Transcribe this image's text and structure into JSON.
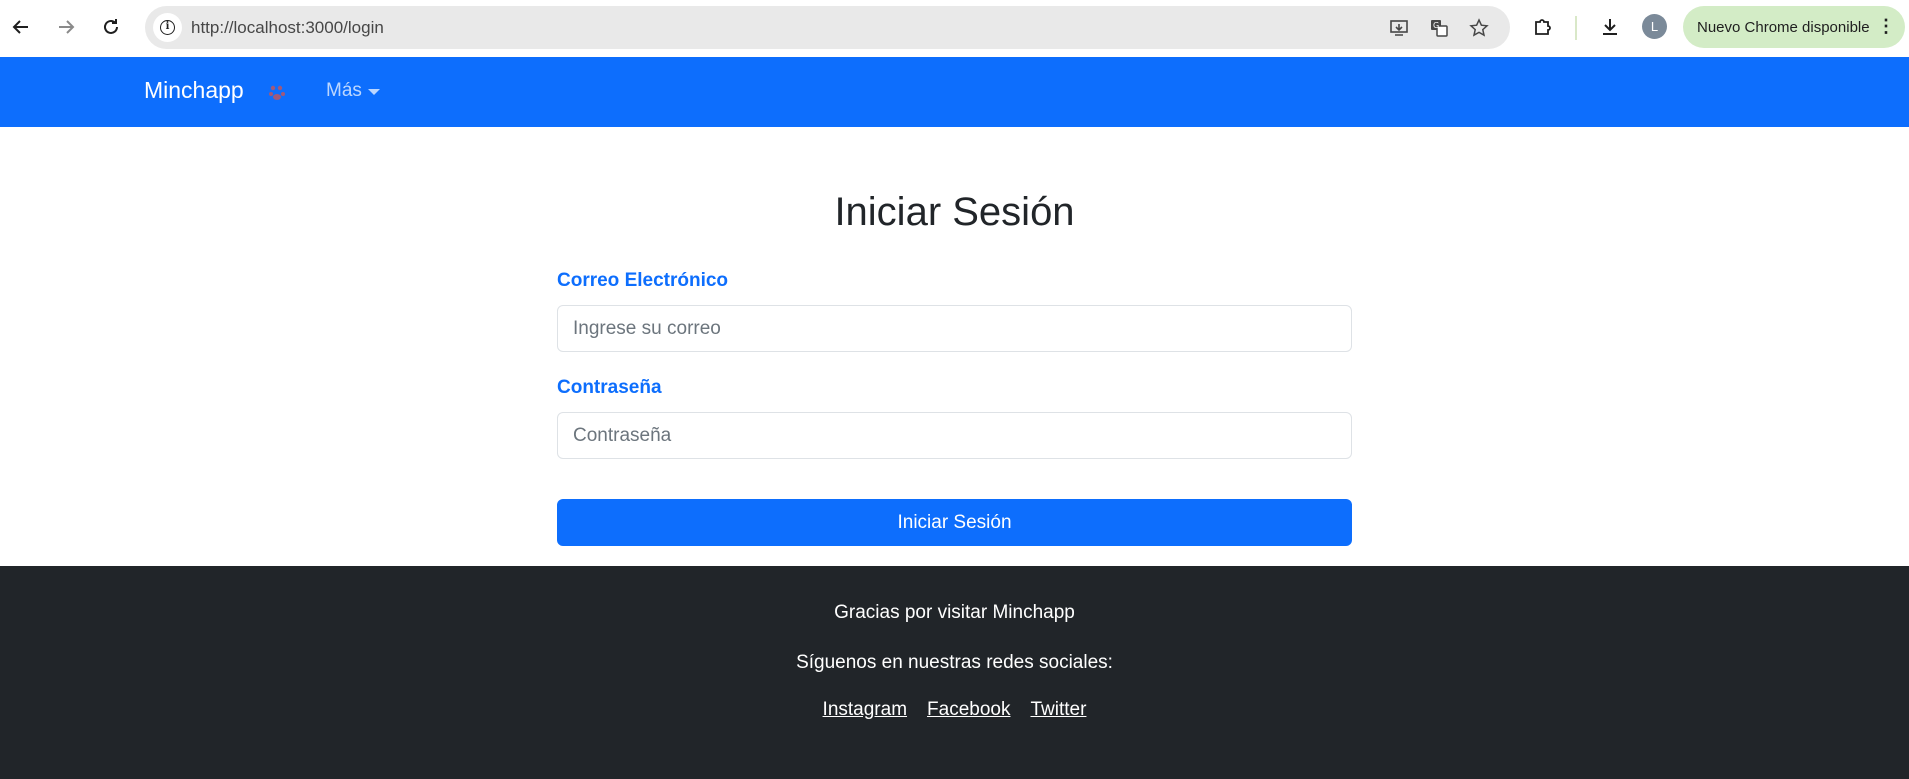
{
  "browser": {
    "url": "http://localhost:3000/login",
    "profile_initial": "L",
    "update_label": "Nuevo Chrome disponible",
    "icons": {
      "back": "arrow-left-icon",
      "forward": "arrow-right-icon",
      "reload": "reload-icon",
      "site_info": "info-icon",
      "install": "install-app-icon",
      "translate": "translate-icon",
      "bookmark": "star-icon",
      "extensions": "puzzle-icon",
      "downloads": "download-icon",
      "menu": "kebab-menu-icon"
    }
  },
  "navbar": {
    "brand": "Minchapp",
    "brand_icon": "paw-icon",
    "more_label": "Más",
    "color": "#0d6efd"
  },
  "login": {
    "title": "Iniciar Sesión",
    "email_label": "Correo Electrónico",
    "email_placeholder": "Ingrese su correo",
    "email_value": "",
    "password_label": "Contraseña",
    "password_placeholder": "Contraseña",
    "password_value": "",
    "submit_label": "Iniciar Sesión"
  },
  "footer": {
    "thanks": "Gracias por visitar Minchapp",
    "follow": "Síguenos en nuestras redes sociales:",
    "links": [
      "Instagram",
      "Facebook",
      "Twitter"
    ],
    "color": "#212529"
  }
}
